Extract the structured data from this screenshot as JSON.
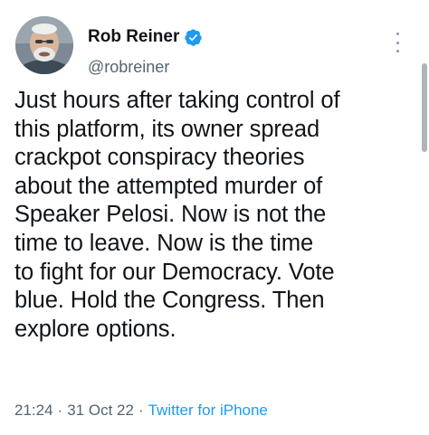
{
  "author": {
    "display_name": "Rob Reiner",
    "handle": "@robreiner",
    "verified": true,
    "avatar_icon": "profile-photo"
  },
  "tweet": {
    "text_lines": [
      "Just hours after taking control of",
      "this platform, its owner spread",
      "crackpot conspiracy theories",
      "about the attempted murder of",
      "Speaker Pelosi. Now is not the",
      "time to leave. Now is the time",
      "to fight for our Democracy. Vote",
      "blue. Hold the Congress. Then",
      "explore options."
    ]
  },
  "meta": {
    "time": "21:24",
    "separator": "·",
    "date": "31 Oct 22",
    "source": "Twitter for iPhone"
  },
  "icons": {
    "verified": "verified-badge-icon",
    "more": "more-options-icon"
  },
  "colors": {
    "accent": "#1d9bf0",
    "text": "#0f1419",
    "secondary": "#536471"
  }
}
